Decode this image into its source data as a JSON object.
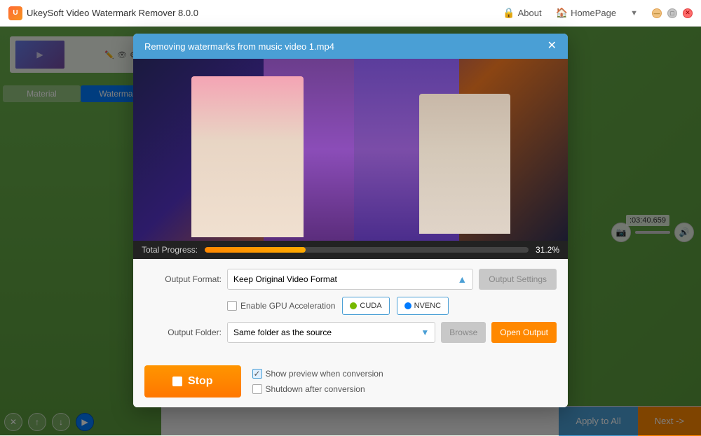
{
  "app": {
    "title": "UkeySoft Video Watermark Remover 8.0.0",
    "logo_char": "U"
  },
  "titlebar": {
    "about_label": "About",
    "homepage_label": "HomePage",
    "min_btn": "—",
    "max_btn": "□",
    "close_btn": "✕"
  },
  "sidebar": {
    "material_tab": "Material",
    "watermark_tab": "Watermark",
    "file_name": "music video 1.mp4"
  },
  "modal": {
    "title": "Removing watermarks from music video 1.mp4",
    "close_btn": "✕",
    "progress_label": "Total Progress:",
    "progress_pct": "31.2%",
    "progress_value": 31.2
  },
  "output_format": {
    "label": "Output Format:",
    "value": "Keep Original Video Format",
    "settings_btn": "Output Settings"
  },
  "gpu": {
    "checkbox_label": "Enable GPU Acceleration",
    "cuda_label": "CUDA",
    "nvenc_label": "NVENC"
  },
  "output_folder": {
    "label": "Output Folder:",
    "value": "Same folder as the source",
    "browse_btn": "Browse",
    "open_btn": "Open Output"
  },
  "stop_button": {
    "label": "Stop"
  },
  "options": {
    "show_preview_label": "Show preview when conversion",
    "shutdown_label": "Shutdown after conversion",
    "show_preview_checked": true,
    "shutdown_checked": false
  },
  "bottom": {
    "apply_all": "Apply to All",
    "next": "Next ->"
  }
}
